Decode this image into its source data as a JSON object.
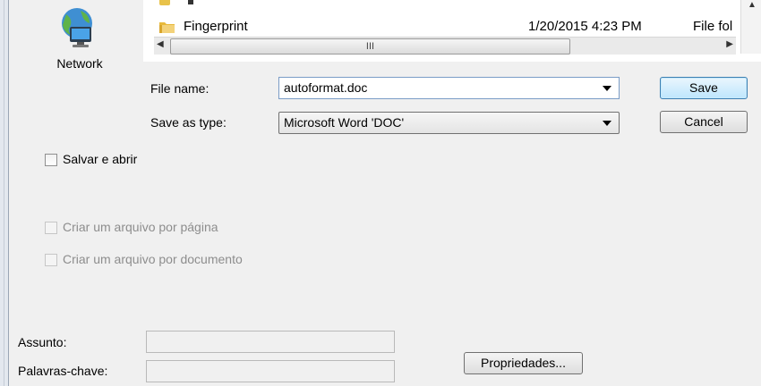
{
  "navigation": {
    "network_label": "Network"
  },
  "file_list": {
    "rows": [
      {
        "name": "Fingerprint",
        "date_modified": "1/20/2015 4:23 PM",
        "type": "File fol"
      }
    ],
    "scroll_thumb_glyph": "III"
  },
  "save_form": {
    "file_name_label": "File name:",
    "file_name_value": "autoformat.doc",
    "save_as_type_label": "Save as type:",
    "save_as_type_value": "Microsoft Word 'DOC'",
    "save_button": "Save",
    "cancel_button": "Cancel"
  },
  "options": {
    "salvar_e_abrir": {
      "label": "Salvar e abrir",
      "checked": false,
      "enabled": true
    },
    "um_arquivo_por_pagina": {
      "label": "Criar um arquivo por página",
      "checked": false,
      "enabled": false
    },
    "um_arquivo_por_documento": {
      "label": "Criar um arquivo por documento",
      "checked": false,
      "enabled": false
    }
  },
  "metadata": {
    "assunto_label": "Assunto:",
    "assunto_value": "",
    "palavras_chave_label": "Palavras-chave:",
    "palavras_chave_value": "",
    "propriedades_button": "Propriedades..."
  },
  "colors": {
    "dialog_bg": "#f0f0f0",
    "primary_button_border": "#3c7fb1",
    "disabled_text": "#8d8d8d"
  }
}
